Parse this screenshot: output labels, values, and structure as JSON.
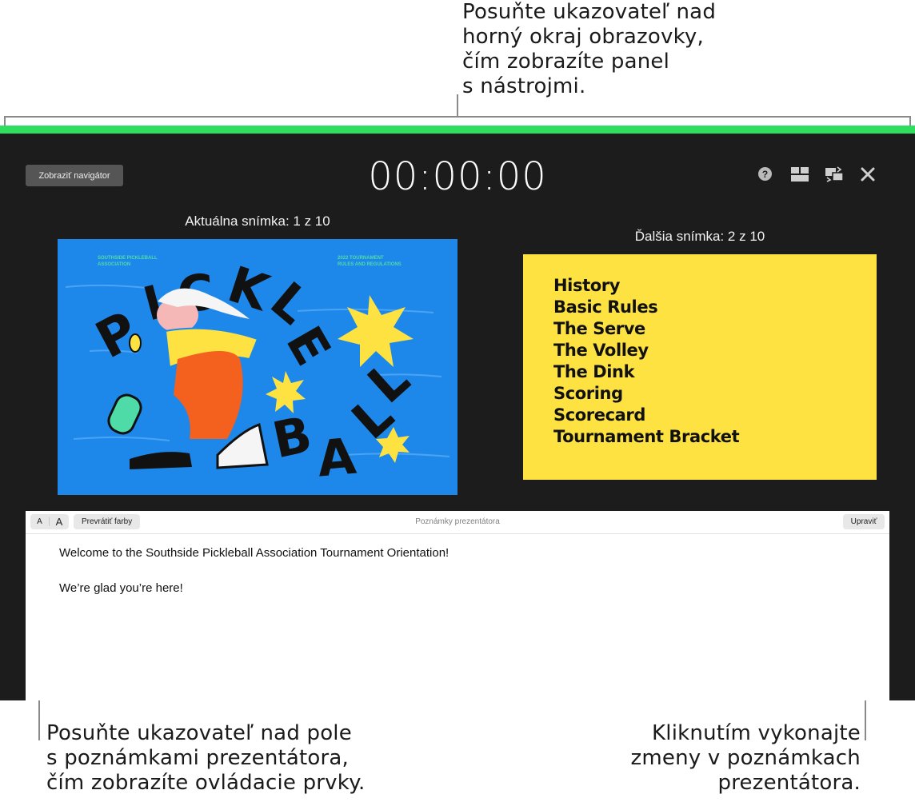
{
  "callouts": {
    "top": "Posuňte ukazovateľ nad\nhorný okraj obrazovky,\nčím zobrazíte panel\ns nástrojmi.",
    "bottom_left": "Posuňte ukazovateľ nad pole\ns poznámkami prezentátora,\nčím zobrazíte ovládacie prvky.",
    "bottom_right": "Kliknutím vykonajte\nzmeny v poznámkach\nprezentátora."
  },
  "toolbar": {
    "navigator_button": "Zobraziť navigátor",
    "timer": "00:00:00",
    "help_glyph": "?",
    "icons": [
      "help-icon",
      "slide-layout-icon",
      "swap-displays-icon",
      "close-icon"
    ]
  },
  "current_slide": {
    "label": "Aktuálna snímka: 1 z 10",
    "org_text": "SOUTHSIDE PICKLEBALL\nASSOCIATION",
    "event_text": "2022 TOURNAMENT\nRULES AND REGULATIONS",
    "title_word_1": "PICKLE",
    "title_word_2": "BALL"
  },
  "next_slide": {
    "label": "Ďalšia snímka: 2 z 10",
    "items": [
      "History",
      "Basic Rules",
      "The Serve",
      "The Volley",
      "The Dink",
      "Scoring",
      "Scorecard",
      "Tournament Bracket"
    ]
  },
  "notes": {
    "font_small": "A",
    "font_large": "A",
    "invert_colors": "Prevrátiť farby",
    "title": "Poznámky prezentátora",
    "edit": "Upraviť",
    "lines": [
      "Welcome to the Southside Pickleball Association Tournament Orientation!",
      "We’re glad you’re here!"
    ]
  },
  "colors": {
    "accent_bar": "#2fde5f",
    "screen_bg": "#1c1c1c",
    "slide1_bg": "#1e88ea",
    "slide2_bg": "#fde242"
  }
}
